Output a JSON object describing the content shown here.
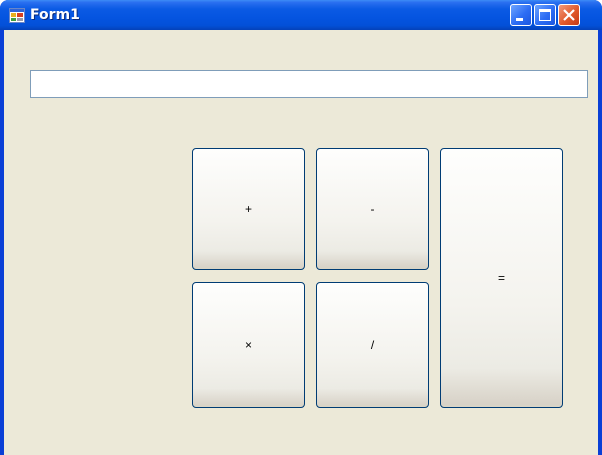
{
  "window": {
    "title": "Form1",
    "icon": "winforms-app-icon",
    "controls": {
      "minimize_icon": "minimize-icon",
      "maximize_icon": "maximize-icon",
      "close_icon": "close-icon"
    }
  },
  "display": {
    "value": "",
    "placeholder": ""
  },
  "buttons": {
    "plus": "+",
    "minus": "-",
    "multiply": "×",
    "divide": "/",
    "equals": "="
  },
  "colors": {
    "titlebar_blue": "#0554e0",
    "client_bg": "#ece9d8",
    "close_red": "#e05a2c",
    "button_border": "#003c74"
  }
}
